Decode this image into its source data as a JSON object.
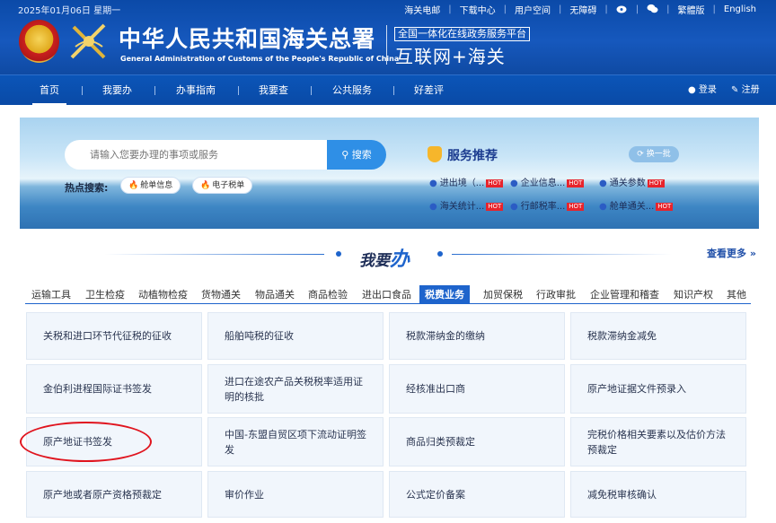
{
  "header": {
    "date": "2025年01月06日 星期一",
    "utility_links": [
      "海关电邮",
      "下载中心",
      "用户空间",
      "无障碍",
      "繁體版",
      "English"
    ],
    "title_cn": "中华人民共和国海关总署",
    "title_en": "General Administration of Customs of the People's Republic of China",
    "platform_label": "全国一体化在线政务服务平台",
    "platform_big": "互联网+海关"
  },
  "nav": {
    "items": [
      "首页",
      "我要办",
      "办事指南",
      "我要查",
      "公共服务",
      "好差评"
    ],
    "active": "首页",
    "login": "登录",
    "register": "注册"
  },
  "banner": {
    "search_placeholder": "请输入您要办理的事项或服务",
    "search_button": "搜索",
    "hot_label": "热点搜索:",
    "hot_items": [
      "舱单信息",
      "电子税单"
    ],
    "service_title": "服务推荐",
    "refresh_label": "换一批",
    "service_items": [
      "进出境（...",
      "企业信息...",
      "通关参数",
      "海关统计...",
      "行邮税率...",
      "舱单通关..."
    ],
    "hot_badge": "HOT"
  },
  "section": {
    "title_prefix": "我要",
    "title_accent": "办",
    "more_label": "查看更多 »"
  },
  "tabs": {
    "items": [
      "运输工具",
      "卫生检疫",
      "动植物检疫",
      "货物通关",
      "物品通关",
      "商品检验",
      "进出口食品",
      "税费业务",
      "加贸保税",
      "行政审批",
      "企业管理和稽查",
      "知识产权",
      "其他"
    ],
    "active": "税费业务"
  },
  "cards": [
    [
      "关税和进口环节代征税的征收",
      "船舶吨税的征收",
      "税款滞纳金的缴纳",
      "税款滞纳金减免"
    ],
    [
      "金伯利进程国际证书签发",
      "进口在途农产品关税税率适用证明的核批",
      "经核准出口商",
      "原产地证据文件预录入"
    ],
    [
      "原产地证书签发",
      "中国-东盟自贸区项下流动证明签发",
      "商品归类预裁定",
      "完税价格相关要素以及估价方法预裁定"
    ],
    [
      "原产地或者原产资格预裁定",
      "审价作业",
      "公式定价备案",
      "减免税审核确认"
    ]
  ],
  "highlight": "原产地证书签发",
  "colors": {
    "header_blue": "#0f4aa3",
    "accent_blue": "#1e64cc",
    "hot_red": "#e8232b",
    "highlight_red": "#e0141e"
  }
}
